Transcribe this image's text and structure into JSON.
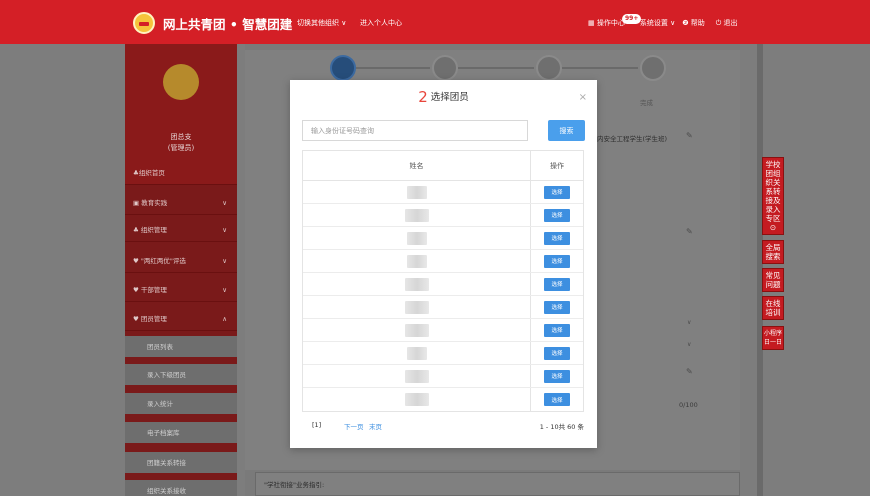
{
  "header": {
    "brand": "网上共青团 • 智慧团建",
    "switch_org": "切换其他组织 ∨",
    "personal_center": "进入个人中心",
    "ops_center": "▦ 操作中心",
    "notification_count": "99+",
    "system_settings": "系统设置 ∨",
    "help": "❷ 帮助",
    "logout": "⏻ 退出"
  },
  "sidebar": {
    "org_name": "团总支",
    "role": "(管理员)",
    "items": [
      {
        "label": "♣组织首页",
        "chevron": ""
      },
      {
        "label": "▣ 教育实践",
        "chevron": "∨"
      },
      {
        "label": "♣ 组织管理",
        "chevron": "∨"
      },
      {
        "label": "♥ \"两红两优\"评选",
        "chevron": "∨"
      },
      {
        "label": "♥ 干部管理",
        "chevron": "∨"
      },
      {
        "label": "♥ 团员管理",
        "chevron": "∧"
      }
    ],
    "subitems": [
      "团员列表",
      "录入下级团员",
      "录入统计",
      "电子档案库",
      "团籍关系转接",
      "组织关系接收"
    ]
  },
  "background": {
    "step_label": "完成",
    "side_text_1": "内安全工程学生(学生班)",
    "side_text_2": "",
    "counter": "0/100",
    "bottom_text": "\"学社衔接\"业务指引:"
  },
  "right_tags": [
    {
      "label": "学校团组织关系转接及录入专区 ⊙"
    },
    {
      "label": "全局搜索"
    },
    {
      "label": "常见问题"
    },
    {
      "label": "在线培训"
    },
    {
      "label": "小程序日一日"
    }
  ],
  "modal": {
    "step_number": "2",
    "title": "选择团员",
    "close": "×",
    "search_placeholder": "输入身份证号码查询",
    "search_button": "搜索",
    "columns": {
      "name": "姓名",
      "action": "操作"
    },
    "rows": [
      {
        "action": "选择"
      },
      {
        "action": "选择"
      },
      {
        "action": "选择"
      },
      {
        "action": "选择"
      },
      {
        "action": "选择"
      },
      {
        "action": "选择"
      },
      {
        "action": "选择"
      },
      {
        "action": "选择"
      },
      {
        "action": "选择"
      },
      {
        "action": "选择"
      }
    ],
    "pagination": {
      "current": "[1]",
      "next": "下一页",
      "last": "末页",
      "total": "1 - 10共 60 条"
    }
  }
}
